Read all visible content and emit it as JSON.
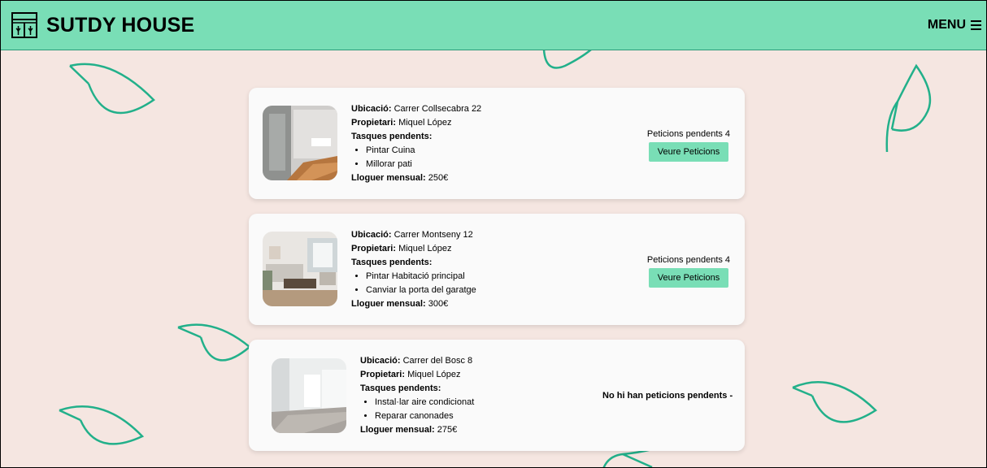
{
  "header": {
    "brand": "SUTDY HOUSE",
    "menu_label": "MENU"
  },
  "labels": {
    "location": "Ubicació:",
    "owner": "Propietari:",
    "tasks": "Tasques pendents:",
    "rent": "Lloguer mensual:"
  },
  "listings": [
    {
      "location": "Carrer Collsecabra 22",
      "owner": "Miquel López",
      "tasks": [
        "Pintar Cuina",
        "Millorar pati"
      ],
      "rent": "250€",
      "requests_text": "Peticions pendents 4",
      "button_label": "Veure Peticions"
    },
    {
      "location": "Carrer Montseny 12",
      "owner": "Miquel López",
      "tasks": [
        "Pintar Habitació principal",
        "Canviar la porta del garatge"
      ],
      "rent": "300€",
      "requests_text": "Peticions pendents 4",
      "button_label": "Veure Peticions"
    },
    {
      "location": "Carrer del Bosc 8",
      "owner": "Miquel López",
      "tasks": [
        "Instal·lar aire condicionat",
        "Reparar canonades"
      ],
      "rent": "275€",
      "no_requests_text": "No hi han peticions pendents -"
    }
  ],
  "colors": {
    "accent": "#79deb6",
    "background": "#f5e6e1",
    "leaf": "#22b08a"
  }
}
